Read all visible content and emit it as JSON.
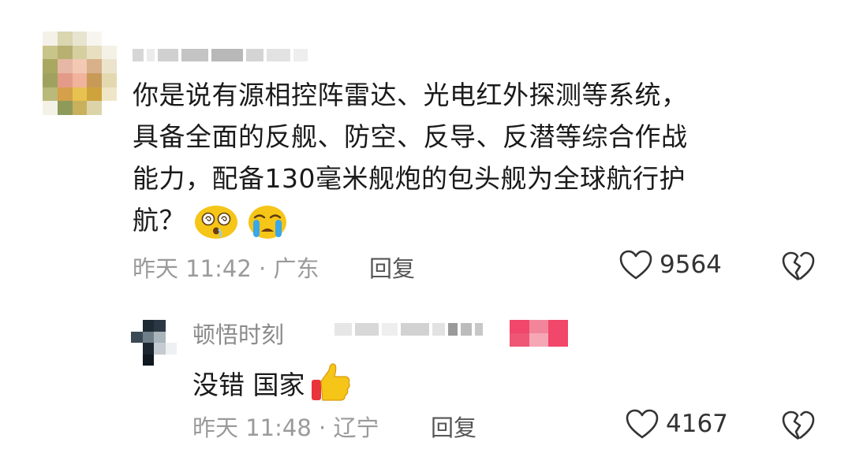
{
  "comment": {
    "lines": [
      "你是说有源相控阵雷达、光电红外探测等系统，",
      "具备全面的反舰、防空、反导、反潜等综合作战",
      "能力，配备130毫米舰炮的包头舰为全球航行护",
      "航？"
    ],
    "emojis": [
      "dizzy-face-emoji",
      "crying-face-emoji"
    ],
    "time_location": "昨天 11:42 · 广东",
    "reply_label": "回复",
    "likes": "9564"
  },
  "reply": {
    "author": "顿悟时刻",
    "text": "没错 国家",
    "emoji": "thumbs-up-emoji",
    "time_location": "昨天 11:48 · 辽宁",
    "reply_label": "回复",
    "likes": "4167"
  },
  "icons": {
    "like": "heart-outline-icon",
    "dislike": "broken-heart-icon"
  },
  "colors": {
    "meta": "#9a9a9a",
    "text": "#1a1a1a",
    "tag": "#f0476a"
  }
}
